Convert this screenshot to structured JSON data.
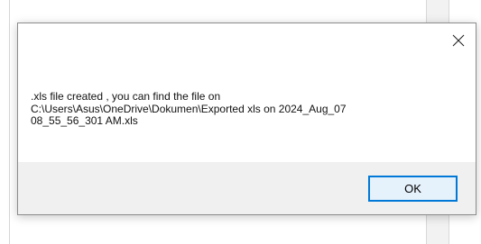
{
  "dialog": {
    "message": ".xls file created , you can find the file on\nC:\\Users\\Asus\\OneDrive\\Dokumen\\Exported xls on 2024_Aug_07\n08_55_56_301 AM.xls",
    "ok_label": "OK",
    "close_icon": "close-icon"
  }
}
